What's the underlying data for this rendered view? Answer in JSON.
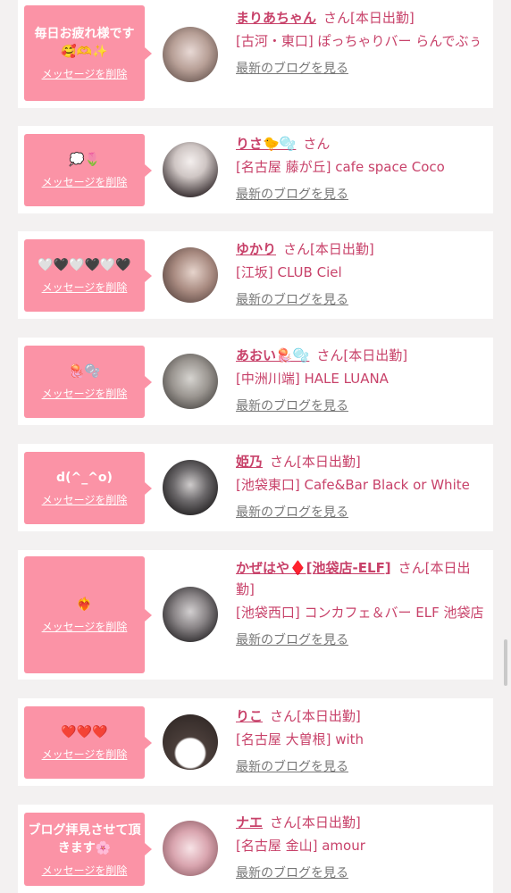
{
  "accent_color": "#fb93a6",
  "name_color": "#c8426a",
  "delete_label": "メッセージを削除",
  "blog_label": "最新のブログを見る",
  "entries": [
    {
      "message": "毎日お疲れ様です🥰🫶✨",
      "name": "まりあちゃん",
      "suffix": "さん[本日出勤]",
      "shop": "[古河・東口] ぽっちゃりバー らんでぶぅ"
    },
    {
      "message": "💭🌷",
      "name": "りさ🐤🫧",
      "suffix": "さん",
      "shop": "[名古屋 藤が丘] cafe space Coco"
    },
    {
      "message": "🤍🖤🤍🖤🤍🖤",
      "name": "ゆかり",
      "suffix": "さん[本日出勤]",
      "shop": "[江坂] CLUB Ciel"
    },
    {
      "message": "🪼🫧",
      "name": "あおい🪼🫧",
      "suffix": "さん[本日出勤]",
      "shop": "[中洲川端] HALE LUANA"
    },
    {
      "message": "d(^_^o)",
      "name": "姫乃",
      "suffix": "さん[本日出勤]",
      "shop": "[池袋東口] Cafe&Bar Black or White"
    },
    {
      "message": "❤️‍🔥",
      "name": "かぜはや♦️[池袋店-ELF]",
      "suffix": "さん[本日出勤]",
      "shop": "[池袋西口] コンカフェ＆バー ELF 池袋店"
    },
    {
      "message": "❤️❤️❤️",
      "name": "りこ",
      "suffix": "さん[本日出勤]",
      "shop": "[名古屋 大曽根] with"
    },
    {
      "message": "ブログ拝見させて頂きます🌸",
      "name": "ナエ",
      "suffix": "さん[本日出勤]",
      "shop": "[名古屋 金山] amour"
    }
  ]
}
